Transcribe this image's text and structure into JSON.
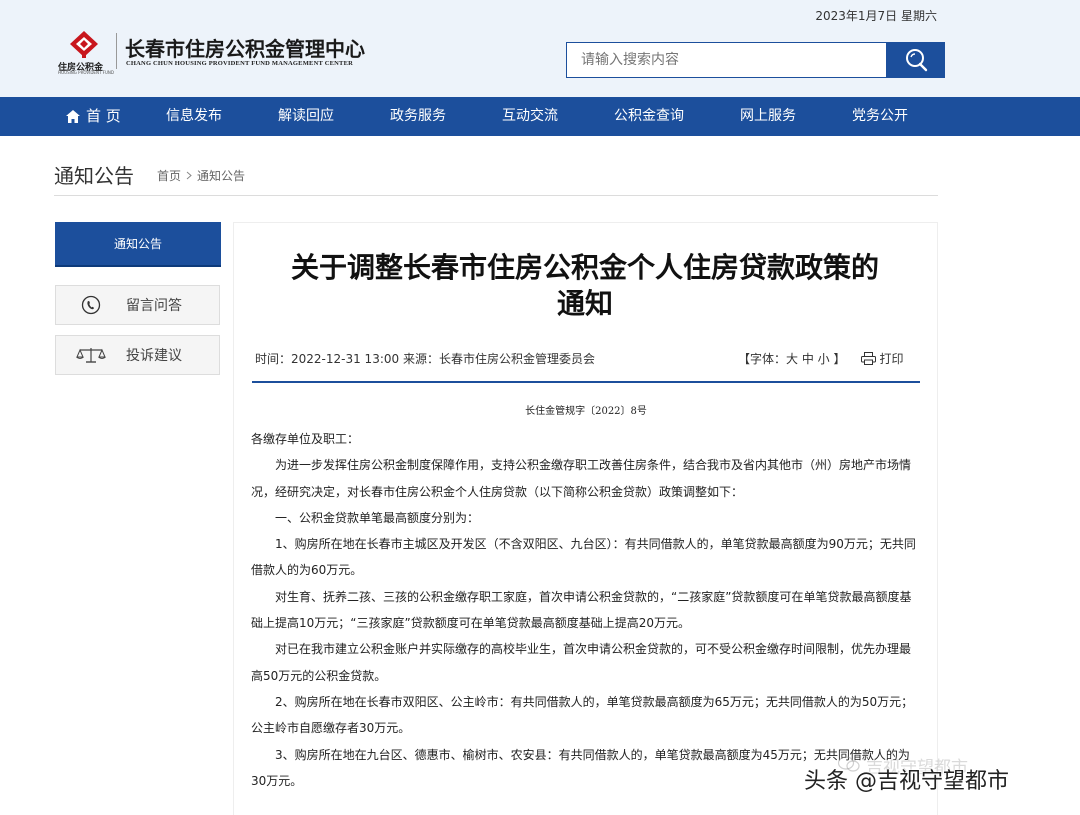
{
  "header": {
    "date": "2023年1月7日 星期六",
    "logo_small": "住房公积金",
    "logo_tiny": "HOUSING PROVIDENT FUND",
    "logo_cn": "长春市住房公积金管理中心",
    "logo_en": "CHANG CHUN HOUSING PROVIDENT FUND MANAGEMENT CENTER",
    "search_placeholder": "请输入搜索内容",
    "brand_color": "#1c4f9c"
  },
  "nav": {
    "items": [
      "首 页",
      "信息发布",
      "解读回应",
      "政务服务",
      "互动交流",
      "公积金查询",
      "网上服务",
      "党务公开"
    ]
  },
  "page": {
    "title": "通知公告",
    "breadcrumb_home": "首页",
    "breadcrumb_current": "通知公告"
  },
  "sidebar": {
    "active": "通知公告",
    "items": [
      {
        "label": "留言问答",
        "icon": "phone-icon"
      },
      {
        "label": "投诉建议",
        "icon": "scales-icon"
      }
    ]
  },
  "article": {
    "title_line1": "关于调整长春市住房公积金个人住房贷款政策的",
    "title_line2": "通知",
    "meta": "时间：2022-12-31 13:00 来源：长春市住房公积金管理委员会",
    "font_control": "【字体：大 中 小 】",
    "print": "打印",
    "doc_no": "长住金管规字〔2022〕8号",
    "paragraphs": [
      "各缴存单位及职工：",
      "为进一步发挥住房公积金制度保障作用，支持公积金缴存职工改善住房条件，结合我市及省内其他市（州）房地产市场情况，经研究决定，对长春市住房公积金个人住房贷款（以下简称公积金贷款）政策调整如下：",
      "一、公积金贷款单笔最高额度分别为：",
      "1、购房所在地在长春市主城区及开发区（不含双阳区、九台区）：有共同借款人的，单笔贷款最高额度为90万元；无共同借款人的为60万元。",
      "对生育、抚养二孩、三孩的公积金缴存职工家庭，首次申请公积金贷款的，“二孩家庭”贷款额度可在单笔贷款最高额度基础上提高10万元；“三孩家庭”贷款额度可在单笔贷款最高额度基础上提高20万元。",
      "对已在我市建立公积金账户并实际缴存的高校毕业生，首次申请公积金贷款的，可不受公积金缴存时间限制，优先办理最高50万元的公积金贷款。",
      "2、购房所在地在长春市双阳区、公主岭市：有共同借款人的，单笔贷款最高额度为65万元；无共同借款人的为50万元；公主岭市自愿缴存者30万元。",
      "3、购房所在地在九台区、德惠市、榆树市、农安县：有共同借款人的，单笔贷款最高额度为45万元；无共同借款人的为30万元。"
    ]
  },
  "watermark": {
    "faint": "吉视守望都市",
    "main": "头条 @吉视守望都市"
  }
}
